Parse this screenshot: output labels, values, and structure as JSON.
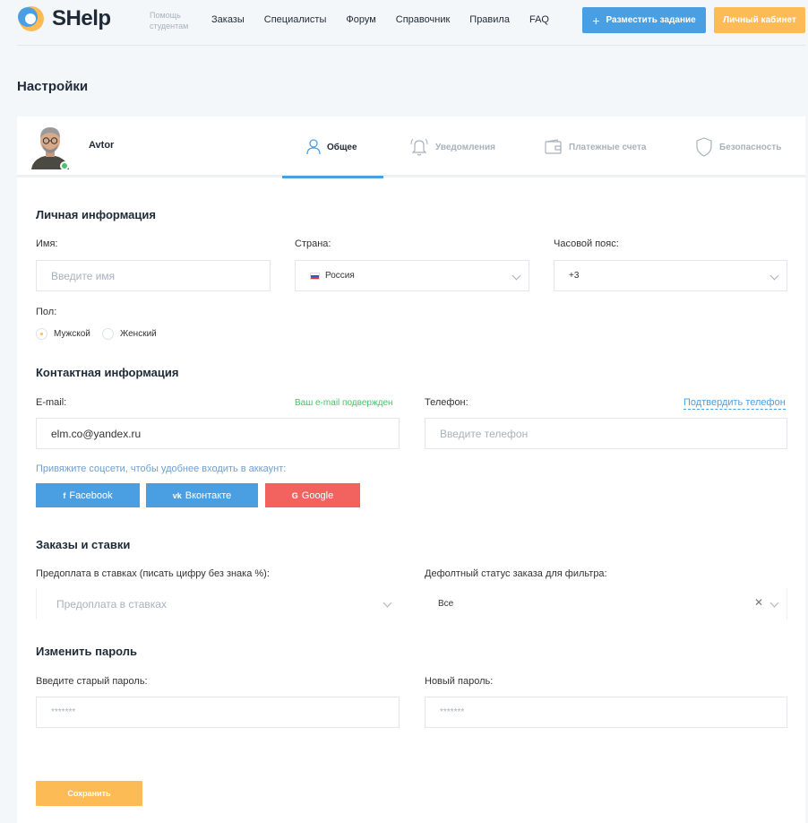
{
  "brand": {
    "name": "SHelp",
    "tagline": "Помощь студентам"
  },
  "nav": {
    "items": [
      "Заказы",
      "Специалисты",
      "Форум",
      "Справочник",
      "Правила",
      "FAQ"
    ]
  },
  "header_buttons": {
    "post_task": "Разместить задание",
    "cabinet": "Личный кабинет"
  },
  "page": {
    "title": "Настройки"
  },
  "profile": {
    "username": "Avtor",
    "online": true
  },
  "tabs": [
    {
      "label": "Общее",
      "icon": "user-icon",
      "active": true
    },
    {
      "label": "Уведомления",
      "icon": "bell-icon",
      "active": false
    },
    {
      "label": "Платежные счета",
      "icon": "wallet-icon",
      "active": false
    },
    {
      "label": "Безопасность",
      "icon": "shield-icon",
      "active": false
    }
  ],
  "personal": {
    "title": "Личная информация",
    "name_label": "Имя:",
    "name_placeholder": "Введите имя",
    "country_label": "Страна:",
    "country_value": "Россия",
    "timezone_label": "Часовой пояс:",
    "timezone_value": "+3",
    "gender_label": "Пол:",
    "gender_options": [
      "Мужской",
      "Женский"
    ],
    "gender_selected": "Мужской"
  },
  "contact": {
    "title": "Контактная информация",
    "email_label": "E-mail:",
    "email_status": "Ваш e-mail подвержден",
    "email_value": "elm.co@yandex.ru",
    "phone_label": "Телефон:",
    "phone_action": "Подтвердить телефон",
    "phone_placeholder": "Введите телефон",
    "social_hint": "Привяжите соцсети, чтобы удобнее входить в аккаунт:",
    "social": {
      "facebook": "Facebook",
      "vk": "Вконтакте",
      "google": "Google"
    }
  },
  "orders": {
    "title": "Заказы и ставки",
    "prepay_label": "Предоплата в ставках (писать цифру без знака %):",
    "prepay_placeholder": "Предоплата в ставках",
    "status_label": "Дефолтный статус заказа для фильтра:",
    "status_value": "Все"
  },
  "password": {
    "title": "Изменить пароль",
    "old_label": "Введите старый пароль:",
    "old_value": "*******",
    "new_label": "Новый пароль:",
    "new_value": "*******"
  },
  "save_label": "Сохранить",
  "colors": {
    "primary": "#4a9fe3",
    "accent": "#fdbb55",
    "google": "#f2635f",
    "success": "#47c46a"
  }
}
